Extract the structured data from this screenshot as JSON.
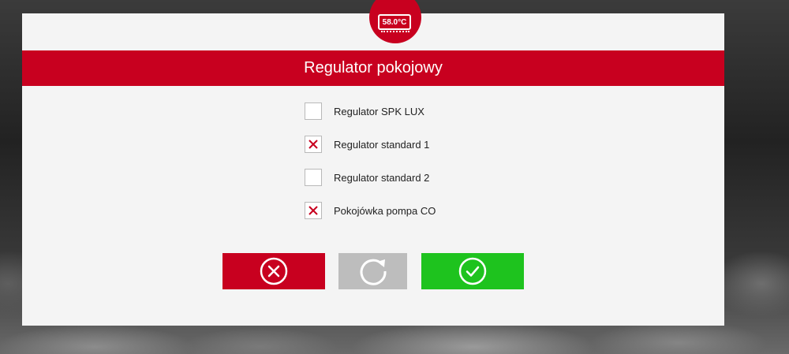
{
  "badge": {
    "temperature": "58.0°C"
  },
  "dialog": {
    "title": "Regulator pokojowy"
  },
  "options": [
    {
      "label": "Regulator SPK LUX",
      "checked": false
    },
    {
      "label": "Regulator standard 1",
      "checked": true
    },
    {
      "label": "Regulator standard 2",
      "checked": false
    },
    {
      "label": "Pokojówka pompa CO",
      "checked": true
    }
  ],
  "buttons": {
    "cancel": {
      "icon": "cancel-circle-icon",
      "color": "#c8001f"
    },
    "reset": {
      "icon": "refresh-icon",
      "color": "#bdbdbd"
    },
    "confirm": {
      "icon": "check-circle-icon",
      "color": "#1ec31e"
    }
  },
  "colors": {
    "accent": "#c8001f",
    "check_mark": "#c8001f",
    "dialog_background": "#f4f4f4"
  }
}
